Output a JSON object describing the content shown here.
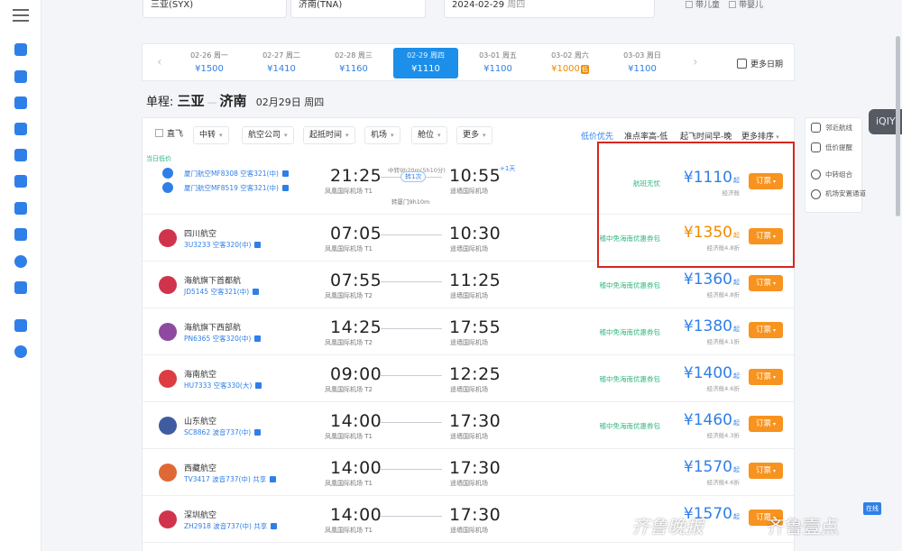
{
  "search": {
    "from": "三亚(SYX)",
    "to": "济南(TNA)",
    "date": "2024-02-29",
    "date_weekday": "周四",
    "child_label": "带儿童",
    "infant_label": "带婴儿"
  },
  "date_strip": {
    "dates": [
      {
        "date": "02-26",
        "weekday": "周一",
        "price": "¥1500"
      },
      {
        "date": "02-27",
        "weekday": "周二",
        "price": "¥1410"
      },
      {
        "date": "02-28",
        "weekday": "周三",
        "price": "¥1160"
      },
      {
        "date": "02-29",
        "weekday": "周四",
        "price": "¥1110",
        "active": true
      },
      {
        "date": "03-01",
        "weekday": "周五",
        "price": "¥1100"
      },
      {
        "date": "03-02",
        "weekday": "周六",
        "price": "¥1000",
        "tag": "低"
      },
      {
        "date": "03-03",
        "weekday": "周日",
        "price": "¥1100"
      }
    ],
    "more_label": "更多日期"
  },
  "route": {
    "prefix": "单程:",
    "from": "三亚",
    "to": "济南",
    "date": "02月29日 周四"
  },
  "filters": {
    "items": [
      "直飞",
      "中转",
      "航空公司",
      "起抵时间",
      "机场",
      "舱位",
      "更多"
    ],
    "sorts": [
      "低价优先",
      "准点率高-低",
      "起飞时间早-晚",
      "更多排序"
    ]
  },
  "lowest_tag": "当日低价",
  "flights": [
    {
      "airline": "",
      "flight_lines": [
        "厦门航空MF8308 空客321(中)",
        "厦门航空MF8519 空客321(中)"
      ],
      "dep_time": "21:25",
      "dep_airport": "凤凰国际机场 T1",
      "arr_time": "10:55",
      "arr_airport": "遥墙国际机场",
      "plus_day": "+1天",
      "stop_top": "中转9h20m(5h10分)",
      "stop_badge": "转1次",
      "stop_bottom": "转厦门9h10m",
      "promo": "航班无忧",
      "price": "¥1110",
      "cabin": "经济舱",
      "color": "blue",
      "book_label": "订票"
    },
    {
      "airline": "四川航空",
      "flight_lines": [
        "3U3233 空客320(中)"
      ],
      "dep_time": "07:05",
      "dep_airport": "凤凰国际机场 T1",
      "arr_time": "10:30",
      "arr_airport": "遥墙国际机场",
      "promo": "稽中免海南优惠券包",
      "price": "¥1350",
      "cabin": "经济舱4.8折",
      "color": "orange",
      "book_label": "订票"
    },
    {
      "airline": "海航旗下首都航",
      "flight_lines": [
        "JD5145 空客321(中)"
      ],
      "dep_time": "07:55",
      "dep_airport": "凤凰国际机场 T2",
      "arr_time": "11:25",
      "arr_airport": "遥墙国际机场",
      "promo": "稽中免海南优惠券包",
      "price": "¥1360",
      "cabin": "经济舱4.8折",
      "color": "blue",
      "book_label": "订票"
    },
    {
      "airline": "海航旗下西部航",
      "flight_lines": [
        "PN6365 空客320(中)"
      ],
      "dep_time": "14:25",
      "dep_airport": "凤凰国际机场 T2",
      "arr_time": "17:55",
      "arr_airport": "遥墙国际机场",
      "promo": "稽中免海南优惠券包",
      "price": "¥1380",
      "cabin": "经济舱4.1折",
      "color": "blue",
      "book_label": "订票"
    },
    {
      "airline": "海南航空",
      "flight_lines": [
        "HU7333 空客330(大)"
      ],
      "dep_time": "09:00",
      "dep_airport": "凤凰国际机场 T2",
      "arr_time": "12:25",
      "arr_airport": "遥墙国际机场",
      "promo": "稽中免海南优惠券包",
      "price": "¥1400",
      "cabin": "经济舱4.6折",
      "color": "blue",
      "book_label": "订票"
    },
    {
      "airline": "山东航空",
      "flight_lines": [
        "SC8862 波音737(中)"
      ],
      "dep_time": "14:00",
      "dep_airport": "凤凰国际机场 T1",
      "arr_time": "17:30",
      "arr_airport": "遥墙国际机场",
      "promo": "稽中免海南优惠券包",
      "price": "¥1460",
      "cabin": "经济舱4.3折",
      "color": "blue",
      "book_label": "订票"
    },
    {
      "airline": "西藏航空",
      "flight_lines": [
        "TV3417 波音737(中) 共享"
      ],
      "dep_time": "14:00",
      "dep_airport": "凤凰国际机场 T1",
      "arr_time": "17:30",
      "arr_airport": "遥墙国际机场",
      "promo": "",
      "price": "¥1570",
      "cabin": "经济舱4.6折",
      "color": "blue",
      "book_label": "订票"
    },
    {
      "airline": "深圳航空",
      "flight_lines": [
        "ZH2918 波音737(中) 共享"
      ],
      "dep_time": "14:00",
      "dep_airport": "凤凰国际机场 T1",
      "arr_time": "17:30",
      "arr_airport": "遥墙国际机场",
      "promo": "",
      "price": "¥1570",
      "cabin": "",
      "color": "blue",
      "book_label": "订票"
    }
  ],
  "price_suffix": "起",
  "side_tools": [
    "邻近航线",
    "低价提醒",
    "中转组合",
    "机场安置通道"
  ],
  "iqiyi_label": "iQIY",
  "watermark": {
    "left": "齐鲁晚报",
    "right": "齐鲁壹点",
    "online": "在线"
  },
  "colors": {
    "accent": "#2f7fe8",
    "book": "#f7931e",
    "highlight": "#d7261e",
    "promo": "#2eb67d"
  }
}
